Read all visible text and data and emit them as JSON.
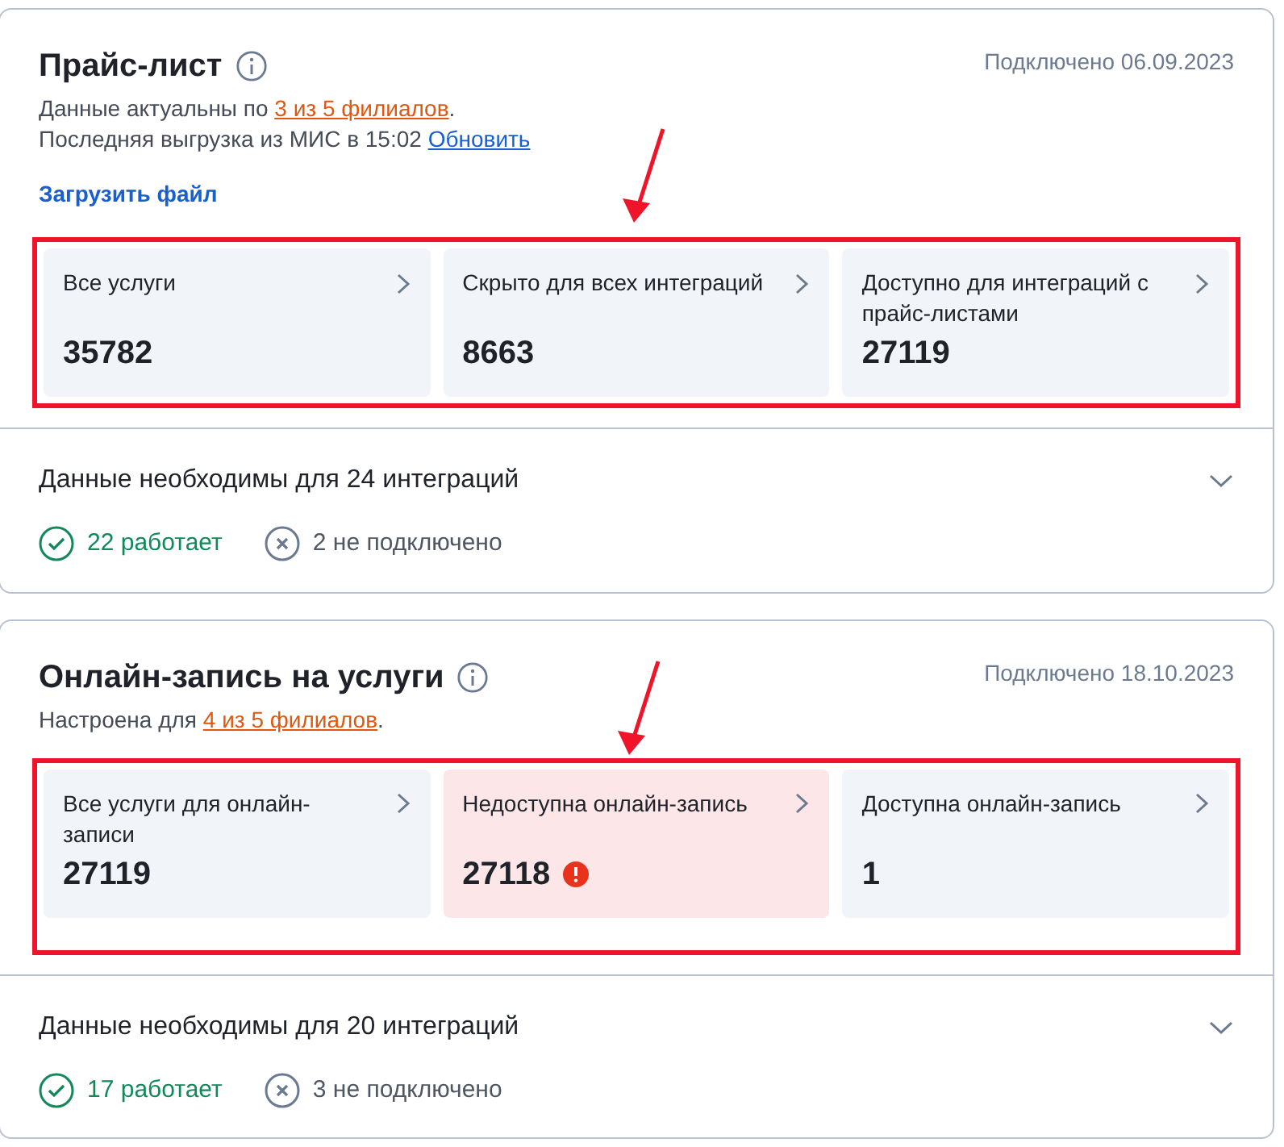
{
  "sections": [
    {
      "title": "Прайс-лист",
      "connected": "Подключено 06.09.2023",
      "highlighted": true,
      "lines": [
        [
          {
            "text": "Данные актуальны по ",
            "kind": "plain"
          },
          {
            "text": "3 из 5 филиалов",
            "kind": "branch_link"
          },
          {
            "text": ".",
            "kind": "plain"
          }
        ],
        [
          {
            "text": "Последняя выгрузка из МИС в 15:02 ",
            "kind": "plain"
          },
          {
            "text": "Обновить",
            "kind": "link"
          }
        ]
      ],
      "action": "Загрузить файл",
      "tiles": [
        {
          "label": "Все услуги",
          "value": "35782",
          "alert": false
        },
        {
          "label": "Скрыто для всех интеграций",
          "value": "8663",
          "alert": false
        },
        {
          "label": "Доступно для интеграций с прайс-листами",
          "value": "27119",
          "alert": false
        }
      ],
      "footer": {
        "title": "Данные необходимы для 24 интеграций",
        "statuses": [
          {
            "kind": "ok",
            "text": "22 работает"
          },
          {
            "kind": "off",
            "text": "2 не подключено"
          }
        ]
      }
    },
    {
      "title": "Онлайн-запись на услуги",
      "connected": "Подключено 18.10.2023",
      "highlighted": true,
      "lines": [
        [
          {
            "text": "Настроена для ",
            "kind": "plain"
          },
          {
            "text": "4 из 5 филиалов",
            "kind": "branch_link"
          },
          {
            "text": ".",
            "kind": "plain"
          }
        ]
      ],
      "tiles": [
        {
          "label": "Все услуги для онлайн-записи",
          "value": "27119",
          "alert": false
        },
        {
          "label": "Недоступна онлайн-запись",
          "value": "27118",
          "alert": true
        },
        {
          "label": "Доступна онлайн-запись",
          "value": "1",
          "alert": false
        }
      ],
      "footer": {
        "title": "Данные необходимы для 20 интеграций",
        "statuses": [
          {
            "kind": "ok",
            "text": "17 работает"
          },
          {
            "kind": "off",
            "text": "3 не подключено"
          }
        ]
      }
    }
  ]
}
